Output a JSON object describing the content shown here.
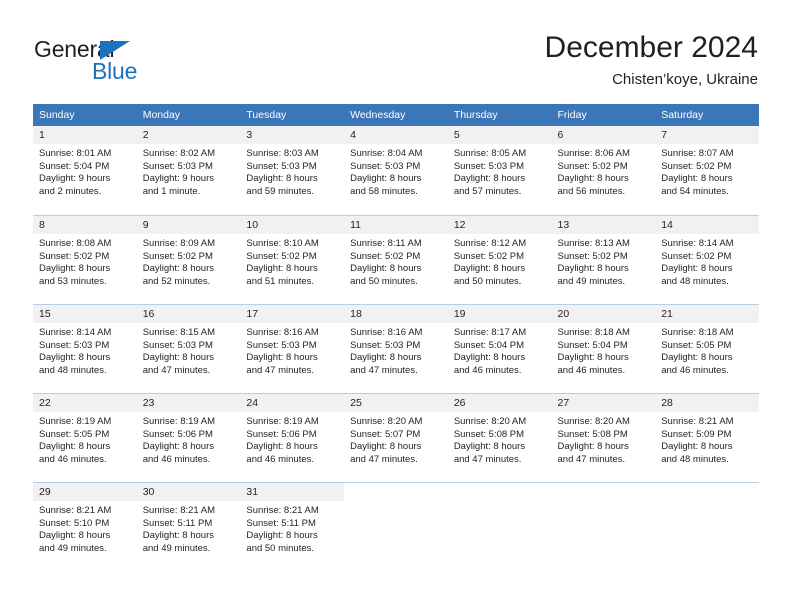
{
  "brand": {
    "name_part1": "General",
    "name_part2": "Blue"
  },
  "header": {
    "title": "December 2024",
    "subtitle": "Chisten’koye, Ukraine"
  },
  "calendar": {
    "weekday_headers": [
      "Sunday",
      "Monday",
      "Tuesday",
      "Wednesday",
      "Thursday",
      "Friday",
      "Saturday"
    ],
    "accent_color": "#3b76b8",
    "daynum_bg": "#f1f1f1",
    "weeks": [
      [
        {
          "day": "1",
          "sunrise": "Sunrise: 8:01 AM",
          "sunset": "Sunset: 5:04 PM",
          "daylight1": "Daylight: 9 hours",
          "daylight2": "and 2 minutes."
        },
        {
          "day": "2",
          "sunrise": "Sunrise: 8:02 AM",
          "sunset": "Sunset: 5:03 PM",
          "daylight1": "Daylight: 9 hours",
          "daylight2": "and 1 minute."
        },
        {
          "day": "3",
          "sunrise": "Sunrise: 8:03 AM",
          "sunset": "Sunset: 5:03 PM",
          "daylight1": "Daylight: 8 hours",
          "daylight2": "and 59 minutes."
        },
        {
          "day": "4",
          "sunrise": "Sunrise: 8:04 AM",
          "sunset": "Sunset: 5:03 PM",
          "daylight1": "Daylight: 8 hours",
          "daylight2": "and 58 minutes."
        },
        {
          "day": "5",
          "sunrise": "Sunrise: 8:05 AM",
          "sunset": "Sunset: 5:03 PM",
          "daylight1": "Daylight: 8 hours",
          "daylight2": "and 57 minutes."
        },
        {
          "day": "6",
          "sunrise": "Sunrise: 8:06 AM",
          "sunset": "Sunset: 5:02 PM",
          "daylight1": "Daylight: 8 hours",
          "daylight2": "and 56 minutes."
        },
        {
          "day": "7",
          "sunrise": "Sunrise: 8:07 AM",
          "sunset": "Sunset: 5:02 PM",
          "daylight1": "Daylight: 8 hours",
          "daylight2": "and 54 minutes."
        }
      ],
      [
        {
          "day": "8",
          "sunrise": "Sunrise: 8:08 AM",
          "sunset": "Sunset: 5:02 PM",
          "daylight1": "Daylight: 8 hours",
          "daylight2": "and 53 minutes."
        },
        {
          "day": "9",
          "sunrise": "Sunrise: 8:09 AM",
          "sunset": "Sunset: 5:02 PM",
          "daylight1": "Daylight: 8 hours",
          "daylight2": "and 52 minutes."
        },
        {
          "day": "10",
          "sunrise": "Sunrise: 8:10 AM",
          "sunset": "Sunset: 5:02 PM",
          "daylight1": "Daylight: 8 hours",
          "daylight2": "and 51 minutes."
        },
        {
          "day": "11",
          "sunrise": "Sunrise: 8:11 AM",
          "sunset": "Sunset: 5:02 PM",
          "daylight1": "Daylight: 8 hours",
          "daylight2": "and 50 minutes."
        },
        {
          "day": "12",
          "sunrise": "Sunrise: 8:12 AM",
          "sunset": "Sunset: 5:02 PM",
          "daylight1": "Daylight: 8 hours",
          "daylight2": "and 50 minutes."
        },
        {
          "day": "13",
          "sunrise": "Sunrise: 8:13 AM",
          "sunset": "Sunset: 5:02 PM",
          "daylight1": "Daylight: 8 hours",
          "daylight2": "and 49 minutes."
        },
        {
          "day": "14",
          "sunrise": "Sunrise: 8:14 AM",
          "sunset": "Sunset: 5:02 PM",
          "daylight1": "Daylight: 8 hours",
          "daylight2": "and 48 minutes."
        }
      ],
      [
        {
          "day": "15",
          "sunrise": "Sunrise: 8:14 AM",
          "sunset": "Sunset: 5:03 PM",
          "daylight1": "Daylight: 8 hours",
          "daylight2": "and 48 minutes."
        },
        {
          "day": "16",
          "sunrise": "Sunrise: 8:15 AM",
          "sunset": "Sunset: 5:03 PM",
          "daylight1": "Daylight: 8 hours",
          "daylight2": "and 47 minutes."
        },
        {
          "day": "17",
          "sunrise": "Sunrise: 8:16 AM",
          "sunset": "Sunset: 5:03 PM",
          "daylight1": "Daylight: 8 hours",
          "daylight2": "and 47 minutes."
        },
        {
          "day": "18",
          "sunrise": "Sunrise: 8:16 AM",
          "sunset": "Sunset: 5:03 PM",
          "daylight1": "Daylight: 8 hours",
          "daylight2": "and 47 minutes."
        },
        {
          "day": "19",
          "sunrise": "Sunrise: 8:17 AM",
          "sunset": "Sunset: 5:04 PM",
          "daylight1": "Daylight: 8 hours",
          "daylight2": "and 46 minutes."
        },
        {
          "day": "20",
          "sunrise": "Sunrise: 8:18 AM",
          "sunset": "Sunset: 5:04 PM",
          "daylight1": "Daylight: 8 hours",
          "daylight2": "and 46 minutes."
        },
        {
          "day": "21",
          "sunrise": "Sunrise: 8:18 AM",
          "sunset": "Sunset: 5:05 PM",
          "daylight1": "Daylight: 8 hours",
          "daylight2": "and 46 minutes."
        }
      ],
      [
        {
          "day": "22",
          "sunrise": "Sunrise: 8:19 AM",
          "sunset": "Sunset: 5:05 PM",
          "daylight1": "Daylight: 8 hours",
          "daylight2": "and 46 minutes."
        },
        {
          "day": "23",
          "sunrise": "Sunrise: 8:19 AM",
          "sunset": "Sunset: 5:06 PM",
          "daylight1": "Daylight: 8 hours",
          "daylight2": "and 46 minutes."
        },
        {
          "day": "24",
          "sunrise": "Sunrise: 8:19 AM",
          "sunset": "Sunset: 5:06 PM",
          "daylight1": "Daylight: 8 hours",
          "daylight2": "and 46 minutes."
        },
        {
          "day": "25",
          "sunrise": "Sunrise: 8:20 AM",
          "sunset": "Sunset: 5:07 PM",
          "daylight1": "Daylight: 8 hours",
          "daylight2": "and 47 minutes."
        },
        {
          "day": "26",
          "sunrise": "Sunrise: 8:20 AM",
          "sunset": "Sunset: 5:08 PM",
          "daylight1": "Daylight: 8 hours",
          "daylight2": "and 47 minutes."
        },
        {
          "day": "27",
          "sunrise": "Sunrise: 8:20 AM",
          "sunset": "Sunset: 5:08 PM",
          "daylight1": "Daylight: 8 hours",
          "daylight2": "and 47 minutes."
        },
        {
          "day": "28",
          "sunrise": "Sunrise: 8:21 AM",
          "sunset": "Sunset: 5:09 PM",
          "daylight1": "Daylight: 8 hours",
          "daylight2": "and 48 minutes."
        }
      ],
      [
        {
          "day": "29",
          "sunrise": "Sunrise: 8:21 AM",
          "sunset": "Sunset: 5:10 PM",
          "daylight1": "Daylight: 8 hours",
          "daylight2": "and 49 minutes."
        },
        {
          "day": "30",
          "sunrise": "Sunrise: 8:21 AM",
          "sunset": "Sunset: 5:11 PM",
          "daylight1": "Daylight: 8 hours",
          "daylight2": "and 49 minutes."
        },
        {
          "day": "31",
          "sunrise": "Sunrise: 8:21 AM",
          "sunset": "Sunset: 5:11 PM",
          "daylight1": "Daylight: 8 hours",
          "daylight2": "and 50 minutes."
        },
        {
          "day": "",
          "sunrise": "",
          "sunset": "",
          "daylight1": "",
          "daylight2": ""
        },
        {
          "day": "",
          "sunrise": "",
          "sunset": "",
          "daylight1": "",
          "daylight2": ""
        },
        {
          "day": "",
          "sunrise": "",
          "sunset": "",
          "daylight1": "",
          "daylight2": ""
        },
        {
          "day": "",
          "sunrise": "",
          "sunset": "",
          "daylight1": "",
          "daylight2": ""
        }
      ]
    ]
  }
}
